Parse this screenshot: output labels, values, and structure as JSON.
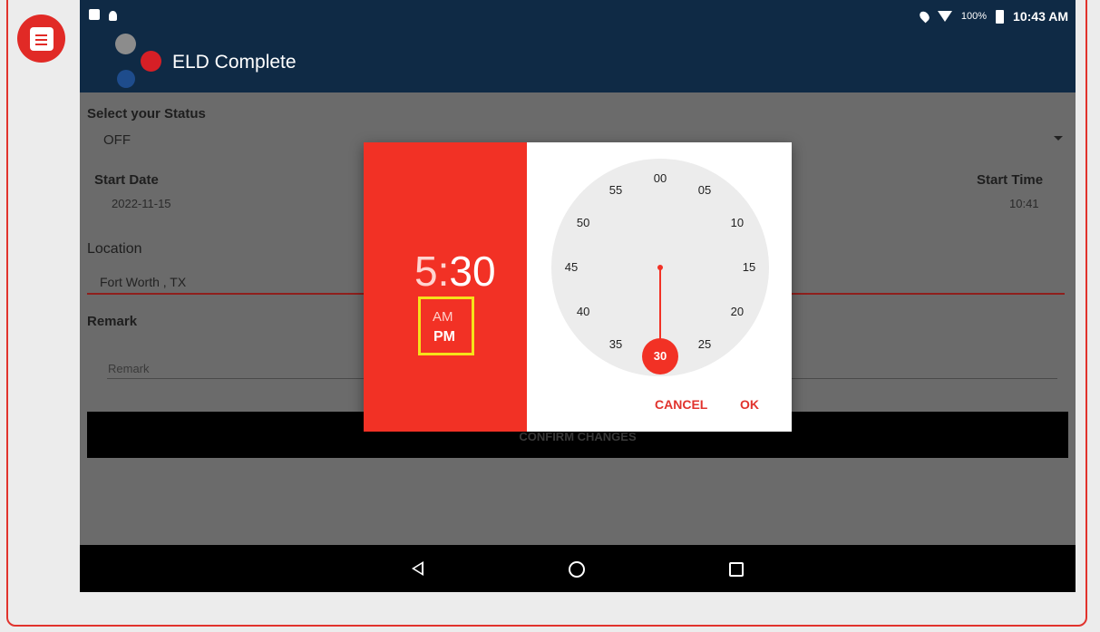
{
  "statusbar": {
    "battery": "100%",
    "time": "10:43 AM"
  },
  "app": {
    "title": "ELD Complete"
  },
  "form": {
    "status_label": "Select your Status",
    "status_value": "OFF",
    "start_date_label": "Start Date",
    "start_date_value": "2022-11-15",
    "start_time_label": "Start Time",
    "start_time_value": "10:41",
    "location_label": "Location",
    "location_value": "Fort Worth , TX",
    "remark_label": "Remark",
    "remark_placeholder": "Remark",
    "confirm_label": "CONFIRM CHANGES"
  },
  "time_picker": {
    "hour": "5",
    "separator": ":",
    "minute": "30",
    "am": "AM",
    "pm": "PM",
    "selected_period": "PM",
    "selected_minute": "30",
    "dial": [
      "00",
      "05",
      "10",
      "15",
      "20",
      "25",
      "30",
      "35",
      "40",
      "45",
      "50",
      "55"
    ],
    "cancel": "CANCEL",
    "ok": "OK"
  },
  "icons": {
    "note": "note-icon",
    "back": "back-icon",
    "home": "home-icon",
    "recents": "recents-icon"
  },
  "colors": {
    "accent": "#f23125",
    "appbar": "#0f2a45",
    "highlight": "#f6e11a"
  }
}
